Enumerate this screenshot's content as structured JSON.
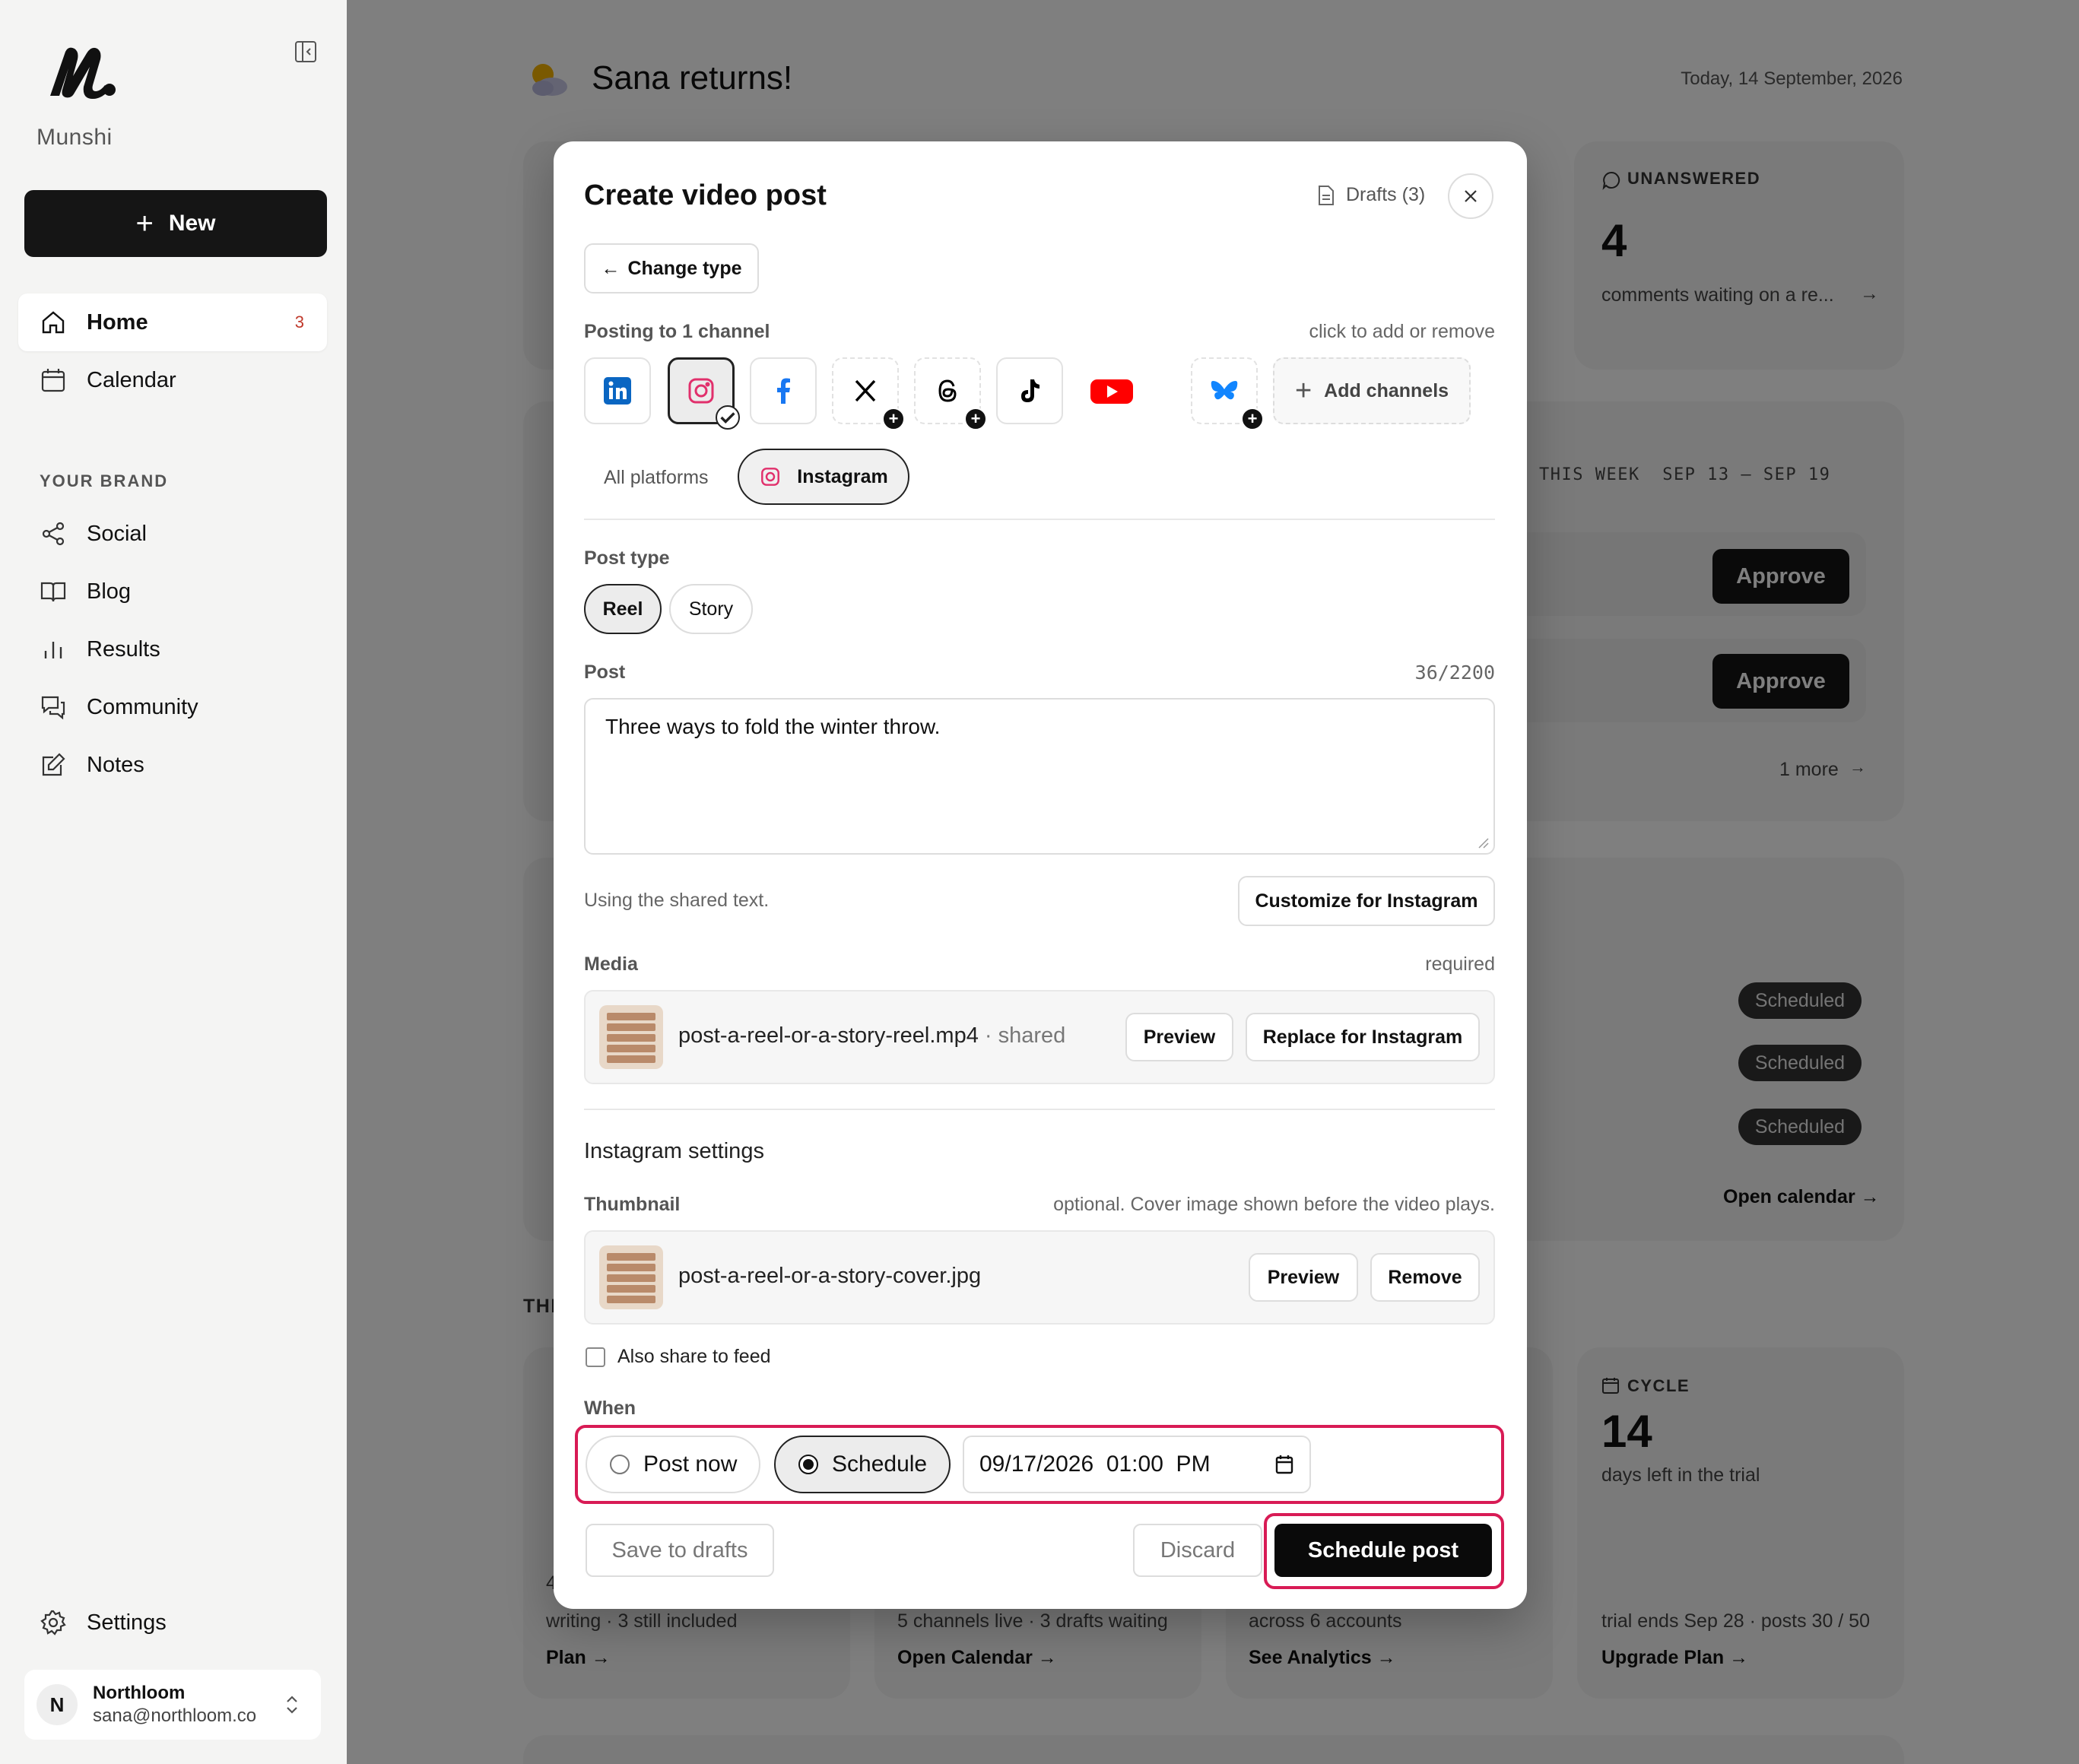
{
  "sidebar": {
    "brand_name": "Munshi",
    "new_label": "New",
    "nav": [
      {
        "label": "Home",
        "badge": "3"
      },
      {
        "label": "Calendar"
      }
    ],
    "section_label": "YOUR BRAND",
    "brand_nav": [
      {
        "label": "Social"
      },
      {
        "label": "Blog"
      },
      {
        "label": "Results"
      },
      {
        "label": "Community"
      },
      {
        "label": "Notes"
      }
    ],
    "settings_label": "Settings",
    "account": {
      "initial": "N",
      "name": "Northloom",
      "email": "sana@northloom.co"
    }
  },
  "main": {
    "greeting": "Sana returns!",
    "today": "Today, 14 September, 2026",
    "unanswered": {
      "label": "UNANSWERED",
      "count": "4",
      "text": "comments waiting on a re...",
      "arrow": "→"
    },
    "week": {
      "label": "THIS WEEK  SEP 13 – SEP 19",
      "approve_1": "Approve",
      "approve_2": "Approve",
      "more": "1 more",
      "arrow": "→"
    },
    "scheduled": {
      "pills": [
        "Scheduled",
        "Scheduled",
        "Scheduled"
      ],
      "link": "Open calendar →"
    },
    "section_peek": "THI",
    "cards": {
      "plan": {
        "text": "writing · 3 still included",
        "link": "Plan →",
        "peek": "4"
      },
      "calendar": {
        "text": "5 channels live · 3 drafts waiting",
        "link": "Open Calendar →"
      },
      "analytics": {
        "text": "across 6 accounts",
        "link": "See Analytics →"
      },
      "cycle": {
        "label": "CYCLE",
        "count": "14",
        "sub": "days left in the trial",
        "text": "trial ends Sep 28 · posts 30 / 50",
        "link": "Upgrade Plan →"
      }
    }
  },
  "modal": {
    "title": "Create video post",
    "drafts_label": "Drafts (3)",
    "change_type_label": "Change type",
    "posting_label": "Posting to 1 channel",
    "posting_hint": "click to add or remove",
    "add_channels_label": "Add channels",
    "channels": [
      {
        "icon": "linkedin-icon",
        "color": "#0a66c2",
        "state": "available"
      },
      {
        "icon": "instagram-icon",
        "color": "#e1306c",
        "state": "selected"
      },
      {
        "icon": "facebook-icon",
        "color": "#1877f2",
        "state": "available"
      },
      {
        "icon": "x-icon",
        "color": "#000000",
        "state": "not-connected"
      },
      {
        "icon": "threads-icon",
        "color": "#000000",
        "state": "not-connected"
      },
      {
        "icon": "tiktok-icon",
        "color": "#000000",
        "state": "available"
      },
      {
        "icon": "youtube-icon",
        "color": "#ff0000",
        "state": "available"
      },
      {
        "icon": "bluesky-icon",
        "color": "#1185fe",
        "state": "not-connected"
      }
    ],
    "tabs": {
      "all": "All platforms",
      "instagram": "Instagram"
    },
    "post_type_label": "Post type",
    "post_types": {
      "reel": "Reel",
      "story": "Story"
    },
    "post_label": "Post",
    "post_counter": "36/2200",
    "post_text": "Three ways to fold the winter throw.",
    "shared_text_note": "Using the shared text.",
    "customize_label": "Customize for Instagram",
    "media_label": "Media",
    "media_hint": "required",
    "media_file": "post-a-reel-or-a-story-reel.mp4",
    "media_shared": " · shared",
    "preview_label": "Preview",
    "replace_label": "Replace for Instagram",
    "ig_settings_label": "Instagram settings",
    "thumbnail_label": "Thumbnail",
    "thumbnail_hint": "optional. Cover image shown before the video plays.",
    "thumbnail_file": "post-a-reel-or-a-story-cover.jpg",
    "thumb_preview_label": "Preview",
    "remove_label": "Remove",
    "share_feed_label": "Also share to feed",
    "when_label": "When",
    "post_now_label": "Post now",
    "schedule_label": "Schedule",
    "schedule_datetime": "09/17/2026  01:00  PM",
    "save_drafts_label": "Save to drafts",
    "discard_label": "Discard",
    "schedule_post_label": "Schedule post",
    "highlight_color": "#d81b55"
  }
}
